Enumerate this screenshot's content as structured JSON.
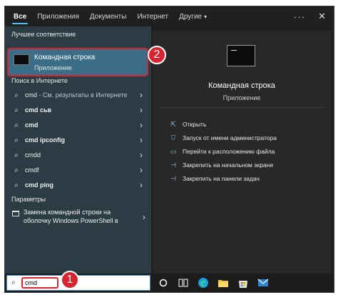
{
  "tabs": [
    {
      "label": "Все",
      "active": true
    },
    {
      "label": "Приложения",
      "active": false
    },
    {
      "label": "Документы",
      "active": false
    },
    {
      "label": "Интернет",
      "active": false
    },
    {
      "label": "Другие",
      "active": false
    }
  ],
  "more_caret": "▾",
  "topbar_icons": {
    "more": "···",
    "close": "✕"
  },
  "left": {
    "best_match_title": "Лучшее соответствие",
    "best_match": {
      "title": "Командная строка",
      "subtitle": "Приложение"
    },
    "web_title": "Поиск в Интернете",
    "web_results": [
      {
        "query": "cmd",
        "hint": " - См. результаты в Интернете"
      },
      {
        "query": "cmd сьв",
        "hint": ""
      },
      {
        "query": "cmd",
        "hint": ""
      },
      {
        "query": "cmd ipconfig",
        "hint": ""
      },
      {
        "query": "cmdd",
        "hint": ""
      },
      {
        "query": "cmdf",
        "hint": ""
      },
      {
        "query": "cmd ping",
        "hint": ""
      }
    ],
    "settings_title": "Параметры",
    "settings_item": "Замена командной строки на оболочку Windows PowerShell в"
  },
  "right": {
    "title": "Командная строка",
    "subtitle": "Приложение",
    "actions": [
      {
        "label": "Открыть",
        "icon": "open-icon"
      },
      {
        "label": "Запуск от имени администратора",
        "icon": "admin-icon"
      },
      {
        "label": "Перейти к расположению файла",
        "icon": "folder-icon"
      },
      {
        "label": "Закрепить на начальном экране",
        "icon": "pin-icon"
      },
      {
        "label": "Закрепить на панели задач",
        "icon": "pin-icon"
      }
    ]
  },
  "search": {
    "value": "cmd"
  },
  "badges": {
    "one": "1",
    "two": "2"
  },
  "colors": {
    "accent": "#4cc2ff",
    "highlight": "#d9232e",
    "best_match_bg": "#3b6d87"
  }
}
